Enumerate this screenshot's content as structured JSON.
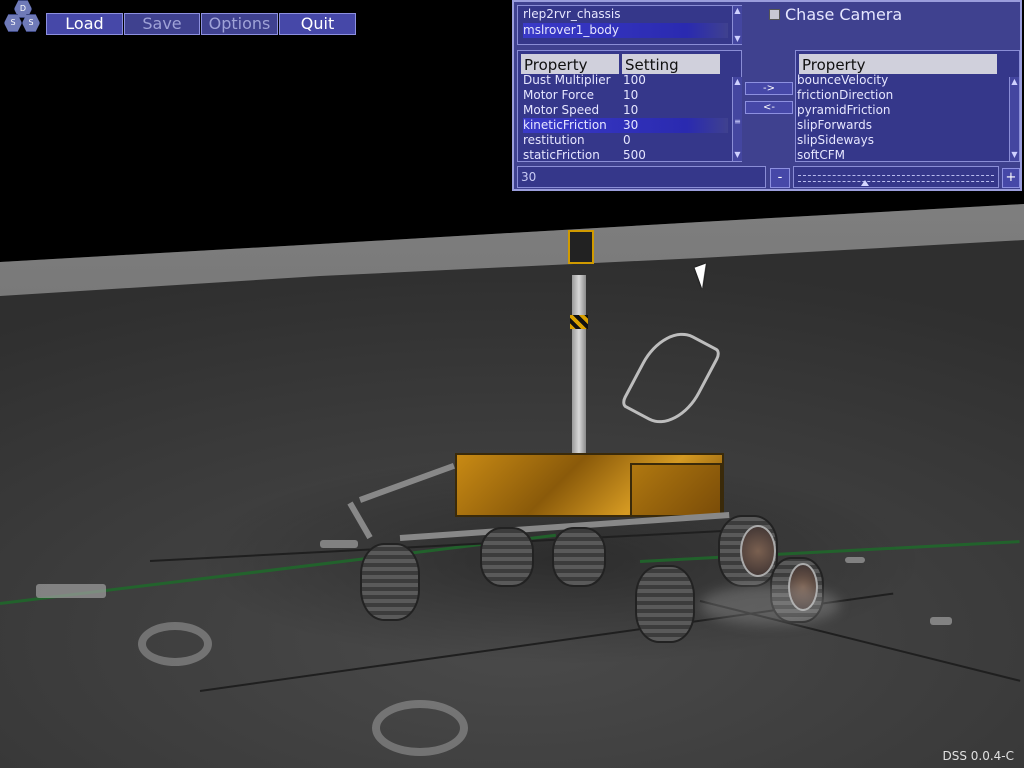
{
  "logo": {
    "letters": [
      "D",
      "S",
      "S"
    ]
  },
  "menu": {
    "load": "Load",
    "save": "Save",
    "options": "Options",
    "quit": "Quit"
  },
  "objects": {
    "items": [
      "rlep2rvr_chassis",
      "mslrover1_body"
    ],
    "selected_index": 1
  },
  "chase_camera": {
    "label": "Chase Camera",
    "checked": false
  },
  "property_table": {
    "headers": [
      "Property",
      "Setting"
    ],
    "rows": [
      {
        "property": "Dust Multiplier",
        "setting": "100"
      },
      {
        "property": "Motor Force",
        "setting": "10"
      },
      {
        "property": "Motor Speed",
        "setting": "10"
      },
      {
        "property": "kineticFriction",
        "setting": "30",
        "selected": true
      },
      {
        "property": "restitution",
        "setting": "0"
      },
      {
        "property": "staticFriction",
        "setting": "500"
      }
    ]
  },
  "transfer": {
    "add": "->",
    "remove": "<-"
  },
  "available_properties": {
    "header": "Property",
    "items": [
      "bounceVelocity",
      "frictionDirection",
      "pyramidFriction",
      "slipForwards",
      "slipSideways",
      "softCFM"
    ]
  },
  "value_field": {
    "value": "30"
  },
  "slider": {
    "minus": "-",
    "plus": "+",
    "level": 0.34
  },
  "version": "DSS 0.0.4-C",
  "colors": {
    "panel": "#3f418f",
    "border": "#9a9ddc",
    "selection": "#3a3ac8"
  }
}
